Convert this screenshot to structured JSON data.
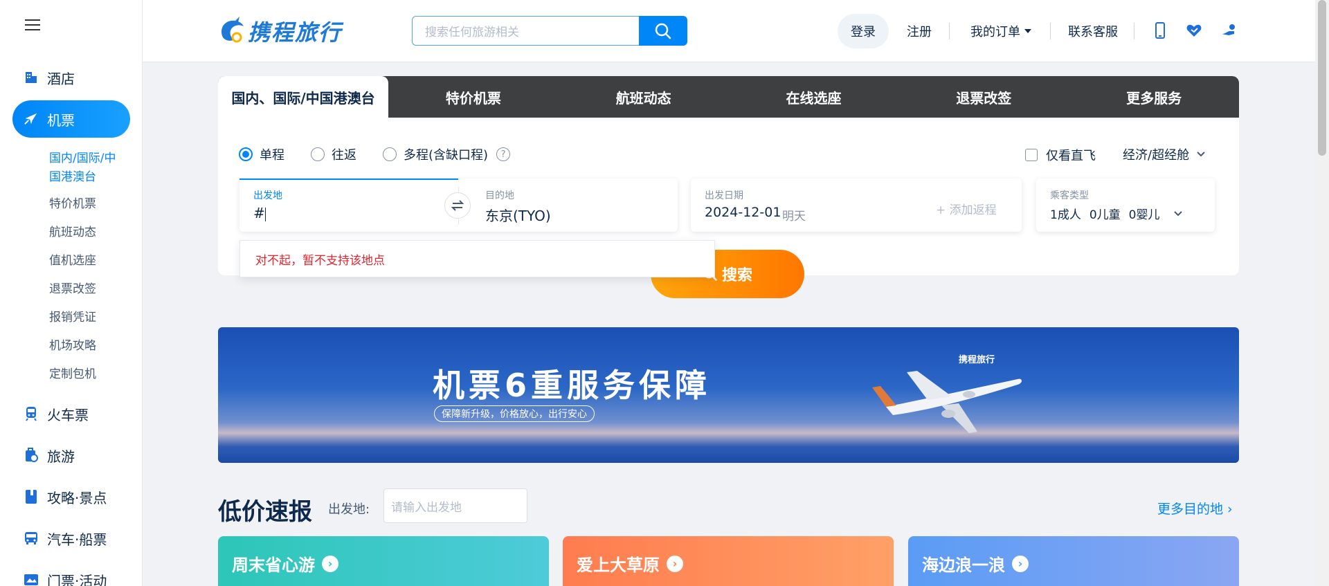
{
  "sidebar": {
    "items": [
      {
        "label": "酒店"
      },
      {
        "label": "机票"
      },
      {
        "label": "火车票"
      },
      {
        "label": "旅游"
      },
      {
        "label": "攻略·景点"
      },
      {
        "label": "汽车·船票"
      },
      {
        "label": "门票·活动"
      }
    ],
    "sub_items": [
      {
        "label": "国内/国际/中"
      },
      {
        "label": "国港澳台"
      },
      {
        "label": "特价机票"
      },
      {
        "label": "航班动态"
      },
      {
        "label": "值机选座"
      },
      {
        "label": "退票改签"
      },
      {
        "label": "报销凭证"
      },
      {
        "label": "机场攻略"
      },
      {
        "label": "定制包机"
      }
    ]
  },
  "header": {
    "logo": "携程旅行",
    "search_placeholder": "搜索任何旅游相关",
    "login": "登录",
    "register": "注册",
    "orders": "我的订单",
    "service": "联系客服"
  },
  "tabs": [
    {
      "label": "国内、国际/中国港澳台"
    },
    {
      "label": "特价机票"
    },
    {
      "label": "航班动态"
    },
    {
      "label": "在线选座"
    },
    {
      "label": "退票改签"
    },
    {
      "label": "更多服务"
    }
  ],
  "form": {
    "trip_types": [
      "单程",
      "往返",
      "多程(含缺口程)"
    ],
    "selected_trip": "单程",
    "help": "?",
    "direct_only": "仅看直飞",
    "cabin": "经济/超经舱",
    "from_label": "出发地",
    "from_value": "#",
    "to_label": "目的地",
    "to_value": "东京(TYO)",
    "date_label": "出发日期",
    "date_value": "2024-12-01",
    "date_hint": "明天",
    "add_return": "+ 添加返程",
    "passenger_label": "乘客类型",
    "adults": "1成人",
    "children": "0儿童",
    "infants": "0婴儿",
    "error": "对不起，暂不支持该地点",
    "search_button": "搜索"
  },
  "banner": {
    "title": "机票6重服务保障",
    "subtitle": "保障新升级，价格放心，出行安心",
    "brand": "携程旅行"
  },
  "deals": {
    "title": "低价速报",
    "from_label": "出发地:",
    "from_placeholder": "请输入出发地",
    "more": "更多目的地",
    "cards": [
      {
        "title": "周末省心游",
        "color": "#32c5c5"
      },
      {
        "title": "爱上大草原",
        "color": "#ff8a5c"
      },
      {
        "title": "海边浪一浪",
        "color": "#6c9cf7"
      }
    ]
  },
  "colors": {
    "primary": "#0086f6",
    "orange": "#ff7700",
    "error": "#e4232e"
  }
}
